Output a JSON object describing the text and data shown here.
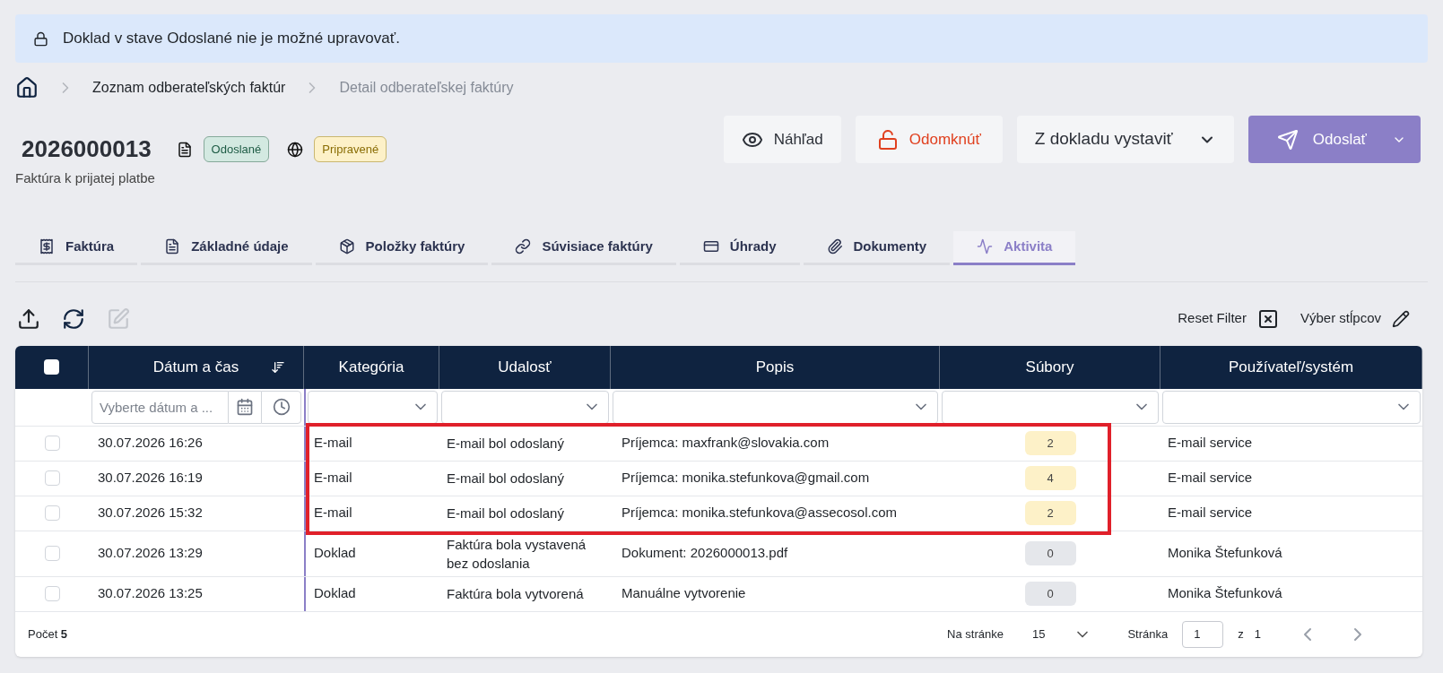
{
  "banner": {
    "text": "Doklad v stave Odoslané nie je možné upravovať."
  },
  "breadcrumbs": [
    {
      "label": "Zoznam odberateľských faktúr",
      "current": false
    },
    {
      "label": "Detail odberateľskej faktúry",
      "current": true
    }
  ],
  "header": {
    "title": "2026000013",
    "subtitle": "Faktúra k prijatej platbe",
    "badges": [
      {
        "kind": "document",
        "label": "Odoslané",
        "color": "#d3e9e1"
      },
      {
        "kind": "web",
        "label": "Pripravené",
        "color": "#fdf1c8"
      }
    ]
  },
  "actions": [
    {
      "kind": "preview",
      "label": "Náhľad"
    },
    {
      "kind": "unlock",
      "label": "Odomknúť"
    },
    {
      "kind": "dropdown",
      "label": "Z dokladu vystaviť"
    },
    {
      "kind": "primary",
      "label": "Odoslať"
    }
  ],
  "tabs": [
    {
      "label": "Faktúra",
      "selected": false
    },
    {
      "label": "Základné údaje",
      "selected": false
    },
    {
      "label": "Položky faktúry",
      "selected": false
    },
    {
      "label": "Súvisiace faktúry",
      "selected": false
    },
    {
      "label": "Úhrady",
      "selected": false
    },
    {
      "label": "Dokumenty",
      "selected": false
    },
    {
      "label": "Aktivita",
      "selected": true
    }
  ],
  "toolbar": {
    "edit_disabled": true,
    "reset_filter": "Reset Filter",
    "columns_picker": "Výber stĺpcov"
  },
  "table": {
    "select_all_checked": false,
    "columns": [
      "Dátum a čas",
      "Kategória",
      "Udalosť",
      "Popis",
      "Súbory",
      "Používateľ/systém"
    ],
    "date_filter_placeholder": "Vyberte dátum a ...",
    "rows": [
      {
        "checked": false,
        "highlighted": true,
        "date": "30.07.2026 16:26",
        "category": "E-mail",
        "event": "E-mail bol odoslaný",
        "description": "Príjemca: maxfrank@slovakia.com",
        "files": "2",
        "color": "#fdf1c8",
        "user": "E-mail service"
      },
      {
        "checked": false,
        "highlighted": true,
        "date": "30.07.2026 16:19",
        "category": "E-mail",
        "event": "E-mail bol odoslaný",
        "description": "Príjemca: monika.stefunkova@gmail.com",
        "files": "4",
        "color": "#fdf1c8",
        "user": "E-mail service"
      },
      {
        "checked": false,
        "highlighted": true,
        "date": "30.07.2026 15:32",
        "category": "E-mail",
        "event": "E-mail bol odoslaný",
        "description": "Príjemca: monika.stefunkova@assecosol.com",
        "files": "2",
        "color": "#fdf1c8",
        "user": "E-mail service"
      },
      {
        "checked": false,
        "highlighted": false,
        "date": "30.07.2026 13:29",
        "category": "Doklad",
        "event": "Faktúra bola vystavená bez odoslania",
        "description": "Dokument: 2026000013.pdf",
        "files": "0",
        "color": "#e5e7eb",
        "user": "Monika Štefunková"
      },
      {
        "checked": false,
        "highlighted": false,
        "date": "30.07.2026 13:25",
        "category": "Doklad",
        "event": "Faktúra bola vytvorená",
        "description": "Manuálne vytvorenie",
        "files": "0",
        "color": "#e5e7eb",
        "user": "Monika Štefunková"
      }
    ],
    "footer": {
      "count": "Počet **5**",
      "per_page_label": "Na stránke",
      "per_page": "15",
      "page_label": "Stránka",
      "page": "1",
      "of": "z",
      "pages": "1"
    }
  }
}
